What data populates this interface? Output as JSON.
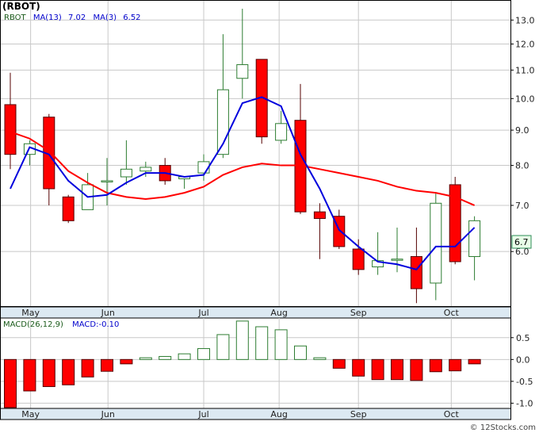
{
  "title": "(RBOT)",
  "watermark": "© 12Stocks.com",
  "colors": {
    "up_fill": "#ffffff",
    "up_stroke": "#2e7d32",
    "down_fill": "#ff0000",
    "down_stroke": "#550000",
    "ma13": "#ff0000",
    "ma3": "#0000dd",
    "axis_bar": "#dce9f2",
    "price_tag": "#e8ffe8",
    "price_tag_border": "#2e8b57"
  },
  "legend": {
    "symbol": "RBOT",
    "ma13_label": "MA(13)",
    "ma13_value": "7.02",
    "ma3_label": "MA(3)",
    "ma3_value": "6.52"
  },
  "macd_legend": {
    "label": "MACD(26,12,9)",
    "value_label": "MACD:-0.10"
  },
  "last_price_tag": "6.7",
  "chart_data": [
    {
      "type": "candlestick",
      "title": "(RBOT)",
      "x_months": [
        "May",
        "Jun",
        "Jul",
        "Aug",
        "Sep",
        "Oct"
      ],
      "y_ticks": [
        "6.0",
        "7.0",
        "8.0",
        "9.0",
        "10.0",
        "11.0",
        "12.0",
        "13.0"
      ],
      "y_tick_values": [
        6,
        7,
        8,
        9,
        10,
        11,
        12,
        13
      ],
      "ylim": [
        5.0,
        13.9
      ],
      "y_scale": "log",
      "grid": true,
      "candles": [
        {
          "open": 9.8,
          "high": 10.9,
          "low": 7.9,
          "close": 8.3
        },
        {
          "open": 8.3,
          "high": 8.7,
          "low": 8.0,
          "close": 8.6
        },
        {
          "open": 9.4,
          "high": 9.5,
          "low": 7.0,
          "close": 7.4
        },
        {
          "open": 7.2,
          "high": 7.25,
          "low": 6.6,
          "close": 6.65
        },
        {
          "open": 6.9,
          "high": 7.8,
          "low": 6.9,
          "close": 7.5
        },
        {
          "open": 7.6,
          "high": 8.2,
          "low": 7.0,
          "close": 7.6
        },
        {
          "open": 7.7,
          "high": 8.7,
          "low": 7.5,
          "close": 7.9
        },
        {
          "open": 7.85,
          "high": 8.1,
          "low": 7.7,
          "close": 7.95
        },
        {
          "open": 8.0,
          "high": 8.2,
          "low": 7.5,
          "close": 7.6
        },
        {
          "open": 7.65,
          "high": 7.7,
          "low": 7.4,
          "close": 7.7
        },
        {
          "open": 7.8,
          "high": 8.3,
          "low": 7.6,
          "close": 8.1
        },
        {
          "open": 8.3,
          "high": 12.4,
          "low": 8.2,
          "close": 10.3
        },
        {
          "open": 10.7,
          "high": 13.5,
          "low": 10.0,
          "close": 11.2
        },
        {
          "open": 11.4,
          "high": 11.4,
          "low": 8.6,
          "close": 8.8
        },
        {
          "open": 8.7,
          "high": 9.6,
          "low": 8.6,
          "close": 9.2
        },
        {
          "open": 9.3,
          "high": 10.5,
          "low": 6.8,
          "close": 6.85
        },
        {
          "open": 6.85,
          "high": 7.05,
          "low": 5.85,
          "close": 6.7
        },
        {
          "open": 6.75,
          "high": 6.9,
          "low": 6.05,
          "close": 6.1
        },
        {
          "open": 6.05,
          "high": 6.25,
          "low": 5.55,
          "close": 5.65
        },
        {
          "open": 5.7,
          "high": 6.4,
          "low": 5.55,
          "close": 5.82
        },
        {
          "open": 5.85,
          "high": 6.5,
          "low": 5.6,
          "close": 5.85
        },
        {
          "open": 5.9,
          "high": 6.5,
          "low": 5.05,
          "close": 5.3
        },
        {
          "open": 5.4,
          "high": 7.3,
          "low": 5.1,
          "close": 7.05
        },
        {
          "open": 7.5,
          "high": 7.7,
          "low": 5.75,
          "close": 5.8
        },
        {
          "open": 5.9,
          "high": 6.75,
          "low": 5.45,
          "close": 6.65
        }
      ],
      "ma13": {
        "name": "MA(13)",
        "values": [
          8.9,
          8.75,
          8.35,
          7.85,
          7.55,
          7.3,
          7.2,
          7.2,
          7.25,
          7.35,
          7.5,
          7.75,
          7.9,
          8.0,
          7.75,
          7.25,
          6.4,
          6.1,
          5.85,
          5.8,
          5.75,
          5.7,
          null,
          null,
          null
        ]
      },
      "ma13_line": {
        "name": "MA(13)",
        "x_index": [
          0,
          1,
          2,
          3,
          4,
          5,
          6,
          7,
          8,
          9,
          10,
          11,
          12,
          13,
          14,
          15,
          16,
          17,
          18,
          19,
          20,
          21,
          22,
          23,
          24
        ],
        "values": [
          8.95,
          8.75,
          8.4,
          7.85,
          7.55,
          7.3,
          7.2,
          7.15,
          7.2,
          7.3,
          7.45,
          7.75,
          7.95,
          8.05,
          8.0,
          8.0,
          7.9,
          7.8,
          7.7,
          7.6,
          7.45,
          7.35,
          7.3,
          7.2,
          7.0
        ]
      },
      "ma3_line": {
        "name": "MA(3)",
        "x_index": [
          0,
          1,
          2,
          3,
          4,
          5,
          6,
          7,
          8,
          9,
          10,
          11,
          12,
          13,
          14,
          15,
          16,
          17,
          18,
          19,
          20,
          21,
          22,
          23,
          24
        ],
        "values": [
          7.4,
          8.5,
          8.3,
          7.6,
          7.2,
          7.25,
          7.55,
          7.8,
          7.8,
          7.7,
          7.75,
          8.6,
          9.85,
          10.05,
          9.75,
          8.3,
          7.4,
          6.45,
          6.1,
          5.8,
          5.75,
          5.65,
          6.1,
          6.1,
          6.5
        ]
      }
    },
    {
      "type": "bar",
      "title": "MACD(26,12,9)",
      "y_ticks": [
        "0.5",
        "0.0",
        "-0.5",
        "-1.0"
      ],
      "y_tick_values": [
        0.5,
        0.0,
        -0.5,
        -1.0
      ],
      "ylim": [
        -1.12,
        0.95
      ],
      "grid": true,
      "values": [
        -1.1,
        -0.72,
        -0.62,
        -0.58,
        -0.4,
        -0.27,
        -0.1,
        0.04,
        0.07,
        0.13,
        0.25,
        0.57,
        0.88,
        0.75,
        0.68,
        0.31,
        0.04,
        -0.2,
        -0.38,
        -0.46,
        -0.46,
        -0.48,
        -0.28,
        -0.26,
        -0.1
      ]
    }
  ]
}
